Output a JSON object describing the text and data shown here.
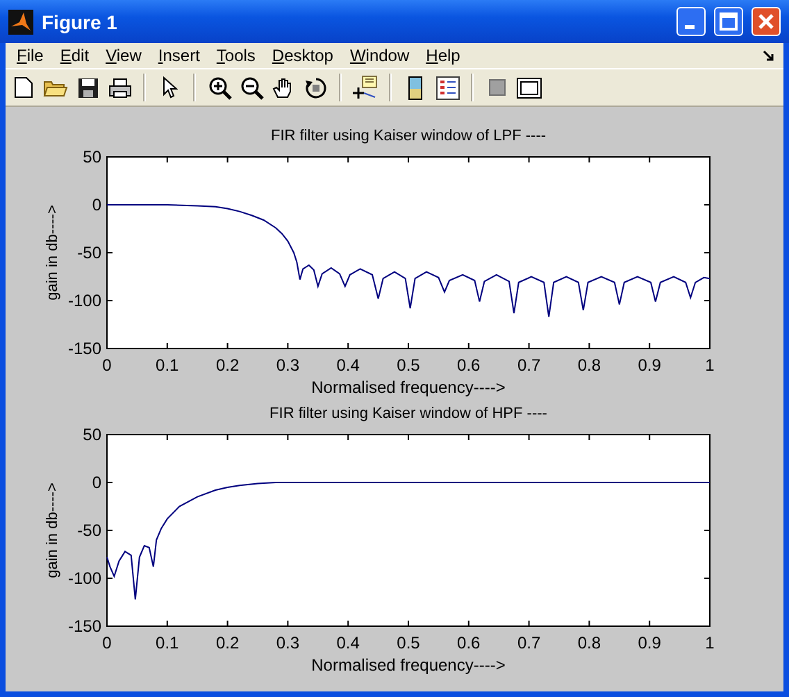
{
  "window": {
    "title": "Figure 1"
  },
  "menu": [
    {
      "label": "File"
    },
    {
      "label": "Edit"
    },
    {
      "label": "View"
    },
    {
      "label": "Insert"
    },
    {
      "label": "Tools"
    },
    {
      "label": "Desktop"
    },
    {
      "label": "Window"
    },
    {
      "label": "Help"
    }
  ],
  "plots": [
    {
      "chart_data": {
        "type": "line",
        "title": "FIR filter using Kaiser window of LPF ----",
        "xlabel": "Normalised frequency---->",
        "ylabel": "gain in db---->",
        "xlim": [
          0,
          1
        ],
        "ylim": [
          -150,
          50
        ],
        "xticks": [
          {
            "value": 0,
            "label": "0"
          },
          {
            "value": 0.1,
            "label": "0.1"
          },
          {
            "value": 0.2,
            "label": "0.2"
          },
          {
            "value": 0.3,
            "label": "0.3"
          },
          {
            "value": 0.4,
            "label": "0.4"
          },
          {
            "value": 0.5,
            "label": "0.5"
          },
          {
            "value": 0.6,
            "label": "0.6"
          },
          {
            "value": 0.7,
            "label": "0.7"
          },
          {
            "value": 0.8,
            "label": "0.8"
          },
          {
            "value": 0.9,
            "label": "0.9"
          },
          {
            "value": 1,
            "label": "1"
          }
        ],
        "yticks": [
          {
            "value": -150,
            "label": "-150"
          },
          {
            "value": -100,
            "label": "-100"
          },
          {
            "value": -50,
            "label": "-50"
          },
          {
            "value": 0,
            "label": "0"
          },
          {
            "value": 50,
            "label": "50"
          }
        ],
        "x": [
          0,
          0.1,
          0.15,
          0.18,
          0.2,
          0.22,
          0.24,
          0.26,
          0.28,
          0.29,
          0.3,
          0.31,
          0.315,
          0.32,
          0.325,
          0.335,
          0.343,
          0.35,
          0.357,
          0.372,
          0.386,
          0.395,
          0.403,
          0.42,
          0.44,
          0.45,
          0.458,
          0.477,
          0.495,
          0.503,
          0.511,
          0.53,
          0.55,
          0.56,
          0.568,
          0.59,
          0.61,
          0.618,
          0.626,
          0.646,
          0.667,
          0.675,
          0.683,
          0.704,
          0.725,
          0.733,
          0.741,
          0.762,
          0.782,
          0.79,
          0.798,
          0.82,
          0.842,
          0.85,
          0.858,
          0.88,
          0.902,
          0.91,
          0.918,
          0.94,
          0.96,
          0.968,
          0.976,
          0.99,
          1
        ],
        "series": [
          {
            "color": "#00007f",
            "values": [
              0,
              0,
              -1,
              -2,
              -4,
              -7,
              -11,
              -16,
              -24,
              -30,
              -38,
              -50,
              -60,
              -78,
              -67,
              -63,
              -68,
              -85,
              -72,
              -66,
              -72,
              -85,
              -73,
              -67,
              -73,
              -98,
              -77,
              -70,
              -77,
              -108,
              -77,
              -70,
              -76,
              -91,
              -79,
              -73,
              -79,
              -101,
              -80,
              -73,
              -80,
              -113,
              -81,
              -75,
              -81,
              -117,
              -81,
              -75,
              -81,
              -110,
              -81,
              -75,
              -81,
              -104,
              -81,
              -75,
              -81,
              -101,
              -81,
              -75,
              -81,
              -97,
              -81,
              -76,
              -77
            ]
          }
        ]
      }
    },
    {
      "chart_data": {
        "type": "line",
        "title": "FIR filter using Kaiser window of HPF ----",
        "xlabel": "Normalised frequency---->",
        "ylabel": "gain in db---->",
        "xlim": [
          0,
          1
        ],
        "ylim": [
          -150,
          50
        ],
        "xticks": [
          {
            "value": 0,
            "label": "0"
          },
          {
            "value": 0.1,
            "label": "0.1"
          },
          {
            "value": 0.2,
            "label": "0.2"
          },
          {
            "value": 0.3,
            "label": "0.3"
          },
          {
            "value": 0.4,
            "label": "0.4"
          },
          {
            "value": 0.5,
            "label": "0.5"
          },
          {
            "value": 0.6,
            "label": "0.6"
          },
          {
            "value": 0.7,
            "label": "0.7"
          },
          {
            "value": 0.8,
            "label": "0.8"
          },
          {
            "value": 0.9,
            "label": "0.9"
          },
          {
            "value": 1,
            "label": "1"
          }
        ],
        "yticks": [
          {
            "value": -150,
            "label": "-150"
          },
          {
            "value": -100,
            "label": "-100"
          },
          {
            "value": -50,
            "label": "-50"
          },
          {
            "value": 0,
            "label": "0"
          },
          {
            "value": 50,
            "label": "50"
          }
        ],
        "x": [
          0,
          0.005,
          0.012,
          0.02,
          0.03,
          0.04,
          0.047,
          0.054,
          0.062,
          0.07,
          0.077,
          0.082,
          0.09,
          0.1,
          0.12,
          0.15,
          0.18,
          0.2,
          0.22,
          0.25,
          0.28,
          0.3,
          1
        ],
        "series": [
          {
            "color": "#00007f",
            "values": [
              -78,
              -88,
              -98,
              -82,
              -72,
              -76,
              -122,
              -78,
              -66,
              -68,
              -88,
              -60,
              -48,
              -38,
              -25,
              -15,
              -8,
              -5,
              -3,
              -1,
              0,
              0,
              0
            ]
          }
        ]
      }
    }
  ]
}
